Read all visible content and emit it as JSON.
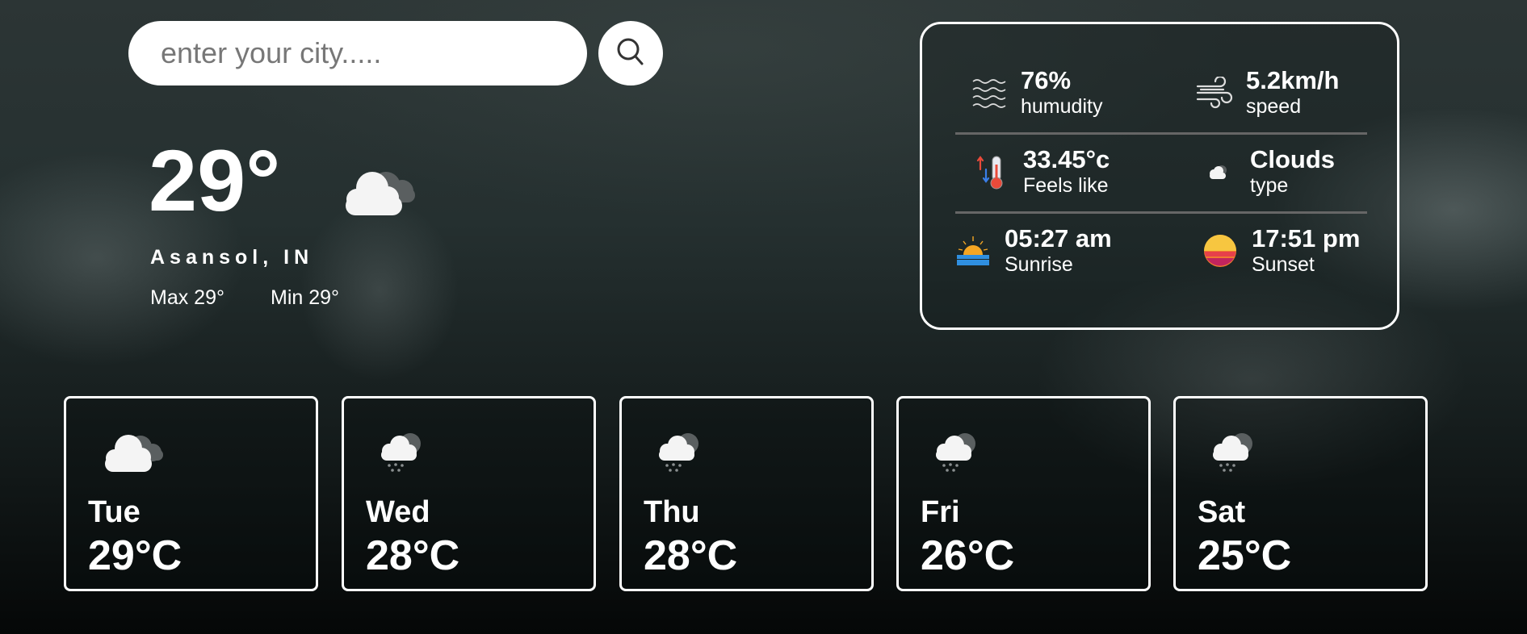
{
  "search": {
    "placeholder": "enter your city....."
  },
  "current": {
    "temperature": "29°",
    "location": "Asansol, IN",
    "max": "Max 29°",
    "min": "Min 29°",
    "icon": "cloud-icon"
  },
  "details": {
    "humidity": {
      "value": "76%",
      "label": "humudity",
      "icon": "humidity-icon"
    },
    "wind": {
      "value": "5.2km/h",
      "label": "speed",
      "icon": "wind-icon"
    },
    "feels_like": {
      "value": "33.45°c",
      "label": "Feels like",
      "icon": "thermometer-icon"
    },
    "type": {
      "value": "Clouds",
      "label": "type",
      "icon": "small-cloud-icon"
    },
    "sunrise": {
      "value": "05:27 am",
      "label": "Sunrise",
      "icon": "sunrise-icon"
    },
    "sunset": {
      "value": "17:51 pm",
      "label": "Sunset",
      "icon": "sunset-icon"
    }
  },
  "forecast": [
    {
      "day": "Tue",
      "temp": "29°C",
      "icon": "cloud-icon"
    },
    {
      "day": "Wed",
      "temp": "28°C",
      "icon": "rain-cloud-icon"
    },
    {
      "day": "Thu",
      "temp": "28°C",
      "icon": "rain-cloud-icon"
    },
    {
      "day": "Fri",
      "temp": "26°C",
      "icon": "rain-cloud-icon"
    },
    {
      "day": "Sat",
      "temp": "25°C",
      "icon": "rain-cloud-icon"
    }
  ]
}
